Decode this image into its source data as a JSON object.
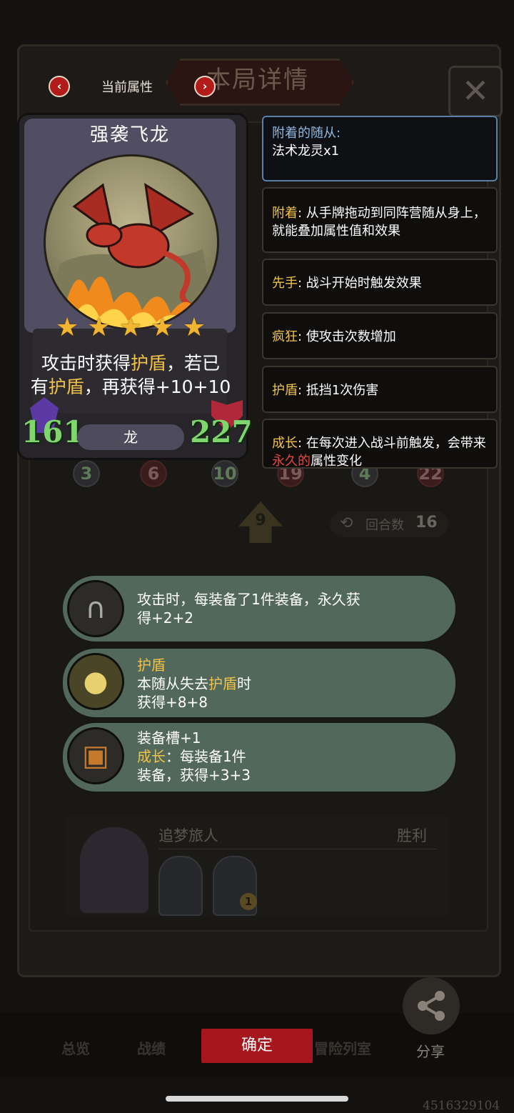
{
  "header": {
    "title": "本局详情",
    "attr_label": "当前属性",
    "prev_glyph": "‹",
    "next_glyph": "›",
    "close_glyph": "✕"
  },
  "card": {
    "name": "强袭飞龙",
    "stars": 5,
    "desc_line1_a": "攻击时获得",
    "desc_line1_hl": "护盾",
    "desc_line1_b": "，若已",
    "desc_line2_a": "有",
    "desc_line2_hl": "护盾",
    "desc_line2_b": "，再获得+10+10",
    "attack": "161",
    "health": "227",
    "tribe": "龙",
    "art_icon": "dragon-art"
  },
  "keywords": {
    "attached_label": "附着的随从:",
    "attached_value": "法术龙灵x1",
    "items": [
      {
        "key": "附着",
        "text": ": 从手牌拖动到同阵营随从身上，就能叠加属性值和效果"
      },
      {
        "key": "先手",
        "text": ": 战斗开始时触发效果"
      },
      {
        "key": "疯狂",
        "text": ": 使攻击次数增加"
      },
      {
        "key": "护盾",
        "text": ": 抵挡1次伤害"
      },
      {
        "key": "成长",
        "text": ": 在每次进入战斗前触发，会带来",
        "hl": "永久的",
        "tail": "属性变化"
      }
    ]
  },
  "board": {
    "tokens": [
      "3",
      "6",
      "10",
      "19",
      "4",
      "22"
    ],
    "level": "9",
    "round_label": "回合数",
    "round_value": "16"
  },
  "abilities": [
    {
      "icon": "horseshoe-icon",
      "glyph": "∩",
      "line1": "攻击时，每装备了1件装备，永久获",
      "line2": "得+2+2"
    },
    {
      "icon": "moon-icon",
      "glyph": "●",
      "key": "护盾",
      "line1_a": "本随从失去",
      "line1_hl": "护盾",
      "line1_b": "时",
      "line2": "获得+8+8"
    },
    {
      "icon": "armor-icon",
      "glyph": "▣",
      "line1": "装备槽+1",
      "key": "成长",
      "line2_b": "：每装备1件",
      "line3": "装备，获得+3+3"
    }
  ],
  "player": {
    "name": "追梦旅人",
    "result": "胜利",
    "badge": "1"
  },
  "bottom": {
    "tabs": [
      "总览",
      "战绩",
      "冒险列室"
    ],
    "confirm": "确定",
    "share": "分享",
    "share_glyph": "⟨",
    "uid": "4516329104"
  },
  "colors": {
    "accent_red": "#a5161d",
    "keyword_gold": "#f0c24a",
    "stat_green": "#7ed66c",
    "banner_green": "#52685a"
  }
}
